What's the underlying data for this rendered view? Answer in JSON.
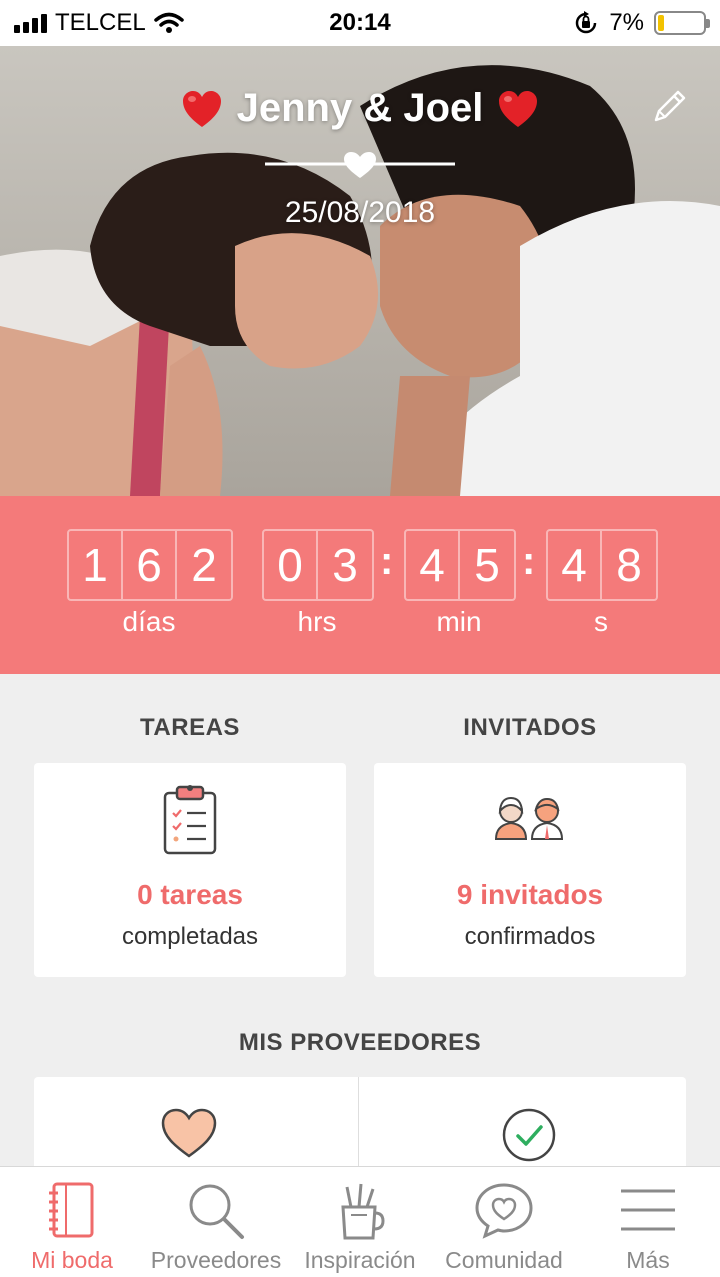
{
  "status_bar": {
    "carrier": "TELCEL",
    "time": "20:14",
    "battery_percent": "7%",
    "battery_level": 0.07,
    "icons": [
      "signal-icon",
      "wifi-icon",
      "rotation-lock-icon",
      "battery-icon"
    ]
  },
  "hero": {
    "couple_names": "Jenny & Joel",
    "wedding_date": "25/08/2018",
    "icons": [
      "heart-emoji-icon",
      "edit-pencil-icon",
      "divider-heart-icon"
    ]
  },
  "countdown": {
    "days": [
      "1",
      "6",
      "2"
    ],
    "hours": [
      "0",
      "3"
    ],
    "minutes": [
      "4",
      "5"
    ],
    "seconds": [
      "4",
      "8"
    ],
    "separator": ":",
    "labels": {
      "days": "días",
      "hours": "hrs",
      "minutes": "min",
      "seconds": "s"
    }
  },
  "tasks": {
    "title": "TAREAS",
    "count_text": "0 tareas",
    "sub_text": "completadas",
    "icon": "clipboard-checklist-icon"
  },
  "guests": {
    "title": "INVITADOS",
    "count_text": "9 invitados",
    "sub_text": "confirmados",
    "icon": "guests-couple-icon"
  },
  "providers": {
    "title": "MIS PROVEEDORES",
    "icons": [
      "heart-icon",
      "check-circle-icon"
    ]
  },
  "tab_bar": {
    "items": [
      {
        "label": "Mi boda",
        "icon": "notebook-icon",
        "active": true
      },
      {
        "label": "Proveedores",
        "icon": "search-icon",
        "active": false
      },
      {
        "label": "Inspiración",
        "icon": "pencil-cup-icon",
        "active": false
      },
      {
        "label": "Comunidad",
        "icon": "chat-heart-icon",
        "active": false
      },
      {
        "label": "Más",
        "icon": "menu-icon",
        "active": false
      }
    ]
  },
  "colors": {
    "accent": "#f47a7a",
    "accent_text": "#ef6b6b",
    "background": "#efefef",
    "battery": "#f2c200"
  }
}
